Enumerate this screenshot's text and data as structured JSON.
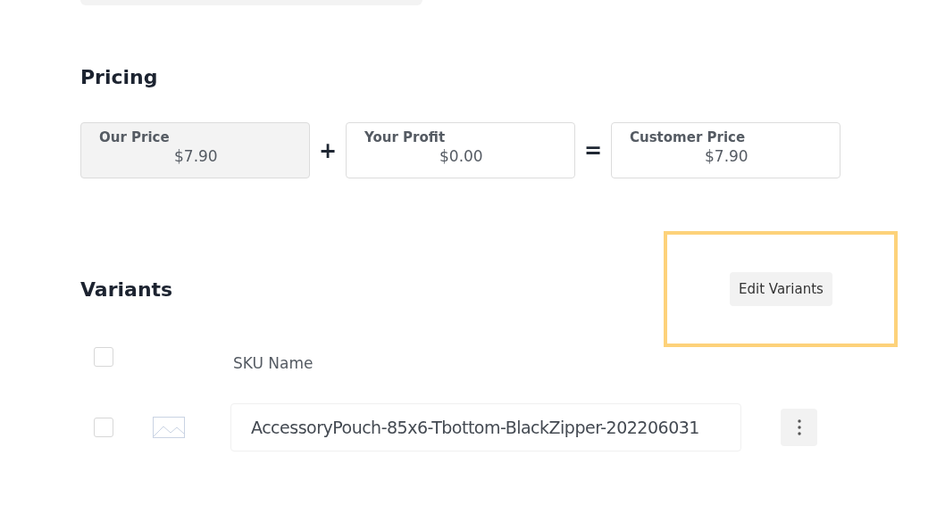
{
  "pricing": {
    "title": "Pricing",
    "fields": [
      {
        "label": "Our Price",
        "value": "$7.90",
        "disabled": true
      },
      {
        "label": "Your Profit",
        "value": "$0.00",
        "disabled": false
      },
      {
        "label": "Customer Price",
        "value": "$7.90",
        "disabled": false
      }
    ],
    "operators": [
      "+",
      "="
    ]
  },
  "variants": {
    "title": "Variants",
    "edit_button": "Edit Variants",
    "highlighted": true,
    "header": {
      "checked": false,
      "column": "SKU Name"
    },
    "rows": [
      {
        "checked": false,
        "sku": "AccessoryPouch-85x6-Tbottom-BlackZipper-202206031"
      }
    ]
  }
}
